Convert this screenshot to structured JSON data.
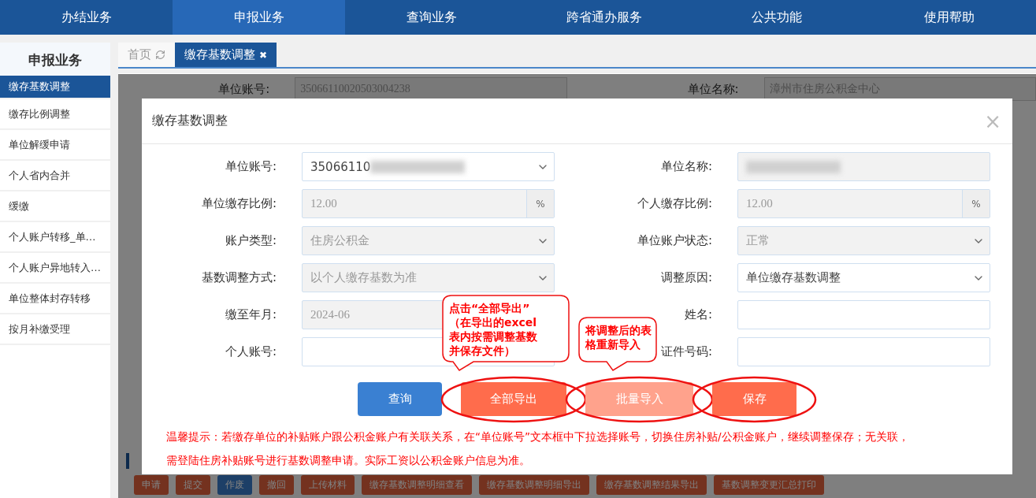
{
  "nav": [
    {
      "label": "办结业务",
      "selected": false
    },
    {
      "label": "申报业务",
      "selected": true
    },
    {
      "label": "查询业务",
      "selected": false
    },
    {
      "label": "跨省通办服务",
      "selected": false
    },
    {
      "label": "公共功能",
      "selected": false
    },
    {
      "label": "使用帮助",
      "selected": false
    }
  ],
  "sidebar": {
    "title": "申报业务",
    "items": [
      {
        "label": "缴存基数调整",
        "selected": true
      },
      {
        "label": "缴存比例调整",
        "selected": false
      },
      {
        "label": "单位解缓申请",
        "selected": false
      },
      {
        "label": "个人省内合并",
        "selected": false
      },
      {
        "label": "缓缴",
        "selected": false
      },
      {
        "label": "个人账户转移_单…",
        "selected": false
      },
      {
        "label": "个人账户异地转入…",
        "selected": false
      },
      {
        "label": "单位整体封存转移",
        "selected": false
      },
      {
        "label": "按月补缴受理",
        "selected": false
      }
    ]
  },
  "tabs": [
    {
      "label": "首页",
      "kind": "home",
      "selected": false
    },
    {
      "label": "缴存基数调整",
      "kind": "page",
      "close": "✖",
      "selected": true
    }
  ],
  "background_form": {
    "fields": [
      {
        "label": "单位账号:",
        "value": "35066110020503004238"
      },
      {
        "label": "单位名称:",
        "value": "漳州市住房公积金中心"
      }
    ],
    "buttons": [
      {
        "label": "申请",
        "kind": "warn"
      },
      {
        "label": "提交",
        "kind": "warn"
      },
      {
        "label": "作废",
        "kind": "info"
      },
      {
        "label": "撤回",
        "kind": "warn"
      },
      {
        "label": "上传材料",
        "kind": "warn"
      },
      {
        "label": "缴存基数调整明细查看",
        "kind": "warn"
      },
      {
        "label": "缴存基数调整明细导出",
        "kind": "warn"
      },
      {
        "label": "缴存基数调整结果导出",
        "kind": "warn"
      },
      {
        "label": "基数调整变更汇总打印",
        "kind": "warn"
      }
    ]
  },
  "dialog": {
    "title": "缴存基数调整",
    "close": "×",
    "fields": [
      {
        "label": "单位账号:",
        "kind": "select",
        "value": "35066110",
        "redacted": true,
        "disabled": false
      },
      {
        "label": "单位名称:",
        "kind": "text",
        "redacted": true,
        "disabled": true
      },
      {
        "label": "单位缴存比例:",
        "kind": "percent",
        "value": "12.00",
        "suffix": "%",
        "disabled": true
      },
      {
        "label": "个人缴存比例:",
        "kind": "percent",
        "value": "12.00",
        "suffix": "%",
        "disabled": true
      },
      {
        "label": "账户类型:",
        "kind": "select",
        "value": "住房公积金",
        "disabled": true
      },
      {
        "label": "单位账户状态:",
        "kind": "select",
        "value": "正常",
        "disabled": true
      },
      {
        "label": "基数调整方式:",
        "kind": "select",
        "value": "以个人缴存基数为准",
        "disabled": true
      },
      {
        "label": "调整原因:",
        "kind": "select",
        "value": "单位缴存基数调整",
        "disabled": false
      },
      {
        "label": "缴至年月:",
        "kind": "text",
        "value": "2024-06",
        "disabled": true
      },
      {
        "label": "姓名:",
        "kind": "text",
        "disabled": false
      },
      {
        "label": "个人账号:",
        "kind": "text",
        "disabled": false
      },
      {
        "label": "证件号码:",
        "kind": "text",
        "disabled": false
      }
    ],
    "buttons": [
      {
        "label": "查询",
        "kind": "primary",
        "disabled": false,
        "circled": false
      },
      {
        "label": "全部导出",
        "kind": "danger",
        "disabled": false,
        "circled": true,
        "callout": {
          "lines": [
            "点击“全部导出”",
            "（在导出的excel",
            "表内按需调整基数",
            "并保存文件）"
          ]
        }
      },
      {
        "label": "批量导入",
        "kind": "danger",
        "disabled": true,
        "circled": true,
        "callout": {
          "lines": [
            "将调整后的表",
            "格重新导入"
          ]
        }
      },
      {
        "label": "保存",
        "kind": "danger",
        "disabled": false,
        "circled": true
      }
    ],
    "notice": [
      "温馨提示：若缴存单位的补贴账户跟公积金账户有关联关系，在“单位账号”文本框中下拉选择账号，切换住房补贴/公积金账户，继续调整保存；无关联，",
      "需登陆住房补贴账号进行基数调整申请。实际工资以公积金账户信息为准。"
    ]
  }
}
